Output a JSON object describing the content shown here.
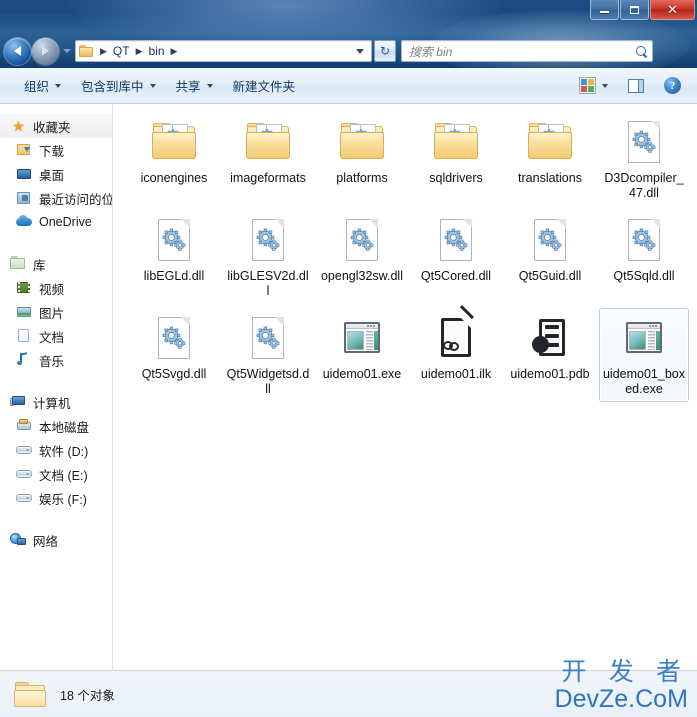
{
  "window": {
    "minimize_label": "Minimize",
    "maximize_label": "Maximize",
    "close_label": "✕"
  },
  "addressbar": {
    "back_label": "Back",
    "forward_label": "Forward",
    "recent_label": "Recent pages",
    "folder_icon": "folder-icon",
    "crumbs": [
      "QT",
      "bin"
    ],
    "separator": "▶",
    "dropdown_label": "Previous locations",
    "refresh_label": "↻"
  },
  "search": {
    "placeholder": "搜索 bin",
    "icon": "search-icon"
  },
  "toolbar": {
    "items": [
      {
        "label": "组织",
        "has_caret": true
      },
      {
        "label": "包含到库中",
        "has_caret": true
      },
      {
        "label": "共享",
        "has_caret": true
      },
      {
        "label": "新建文件夹",
        "has_caret": false
      }
    ],
    "views_icon": "views-icon",
    "views_caret": "chevron-down-icon",
    "preview_pane_icon": "preview-pane-icon",
    "help_icon": "help-icon",
    "help_glyph": "?"
  },
  "sidebar": {
    "groups": [
      {
        "header": {
          "label": "收藏夹",
          "icon": "star-icon",
          "icon_class": "ic-star",
          "glyph": "★"
        },
        "items": [
          {
            "label": "下载",
            "icon": "downloads-icon",
            "icon_class": "ic-download"
          },
          {
            "label": "桌面",
            "icon": "desktop-icon",
            "icon_class": "ic-desktop"
          },
          {
            "label": "最近访问的位置",
            "icon": "recent-places-icon",
            "icon_class": "ic-recent"
          },
          {
            "label": "OneDrive",
            "icon": "onedrive-icon",
            "icon_class": "ic-onedrive"
          }
        ]
      },
      {
        "header": {
          "label": "库",
          "icon": "library-icon",
          "icon_class": "ic-lib",
          "glyph": ""
        },
        "items": [
          {
            "label": "视频",
            "icon": "videos-icon",
            "icon_class": "ic-video"
          },
          {
            "label": "图片",
            "icon": "pictures-icon",
            "icon_class": "ic-pic"
          },
          {
            "label": "文档",
            "icon": "documents-icon",
            "icon_class": "ic-doc"
          },
          {
            "label": "音乐",
            "icon": "music-icon",
            "icon_class": "ic-music"
          }
        ]
      },
      {
        "header": {
          "label": "计算机",
          "icon": "computer-icon",
          "icon_class": "ic-computer",
          "glyph": ""
        },
        "items": [
          {
            "label": "本地磁盘",
            "icon": "local-disk-icon",
            "icon_class": "ic-hdd"
          },
          {
            "label": "软件 (D:)",
            "icon": "drive-icon",
            "icon_class": "ic-drive"
          },
          {
            "label": "文档 (E:)",
            "icon": "drive-icon",
            "icon_class": "ic-drive"
          },
          {
            "label": "娱乐 (F:)",
            "icon": "drive-icon",
            "icon_class": "ic-drive"
          }
        ]
      },
      {
        "header": {
          "label": "网络",
          "icon": "network-icon",
          "icon_class": "ic-net",
          "glyph": ""
        },
        "items": []
      }
    ]
  },
  "files": {
    "items": [
      {
        "name": "iconengines",
        "type": "folder",
        "selected": false
      },
      {
        "name": "imageformats",
        "type": "folder",
        "selected": false
      },
      {
        "name": "platforms",
        "type": "folder",
        "selected": false
      },
      {
        "name": "sqldrivers",
        "type": "folder",
        "selected": false
      },
      {
        "name": "translations",
        "type": "folder",
        "selected": false
      },
      {
        "name": "D3Dcompiler_47.dll",
        "type": "dll",
        "selected": false
      },
      {
        "name": "libEGLd.dll",
        "type": "dll",
        "selected": false
      },
      {
        "name": "libGLESV2d.dll",
        "type": "dll",
        "selected": false
      },
      {
        "name": "opengl32sw.dll",
        "type": "dll",
        "selected": false
      },
      {
        "name": "Qt5Cored.dll",
        "type": "dll",
        "selected": false
      },
      {
        "name": "Qt5Guid.dll",
        "type": "dll",
        "selected": false
      },
      {
        "name": "Qt5Sqld.dll",
        "type": "dll",
        "selected": false
      },
      {
        "name": "Qt5Svgd.dll",
        "type": "dll",
        "selected": false
      },
      {
        "name": "Qt5Widgetsd.dll",
        "type": "dll",
        "selected": false
      },
      {
        "name": "uidemo01.exe",
        "type": "exe",
        "selected": false
      },
      {
        "name": "uidemo01.ilk",
        "type": "ilk",
        "selected": false
      },
      {
        "name": "uidemo01.pdb",
        "type": "pdb",
        "selected": false
      },
      {
        "name": "uidemo01_boxed.exe",
        "type": "exe",
        "selected": true
      }
    ]
  },
  "statusbar": {
    "icon": "folder-icon",
    "text": "18 个对象"
  },
  "watermark": {
    "chinese": "开 发 者",
    "english": "DevZe.CoM",
    "color": "#3478bf"
  },
  "colors": {
    "chrome_blue": "#235586",
    "accent": "#2f74bd",
    "selection_border": "#b8cfe0",
    "close_red": "#c8362a"
  }
}
